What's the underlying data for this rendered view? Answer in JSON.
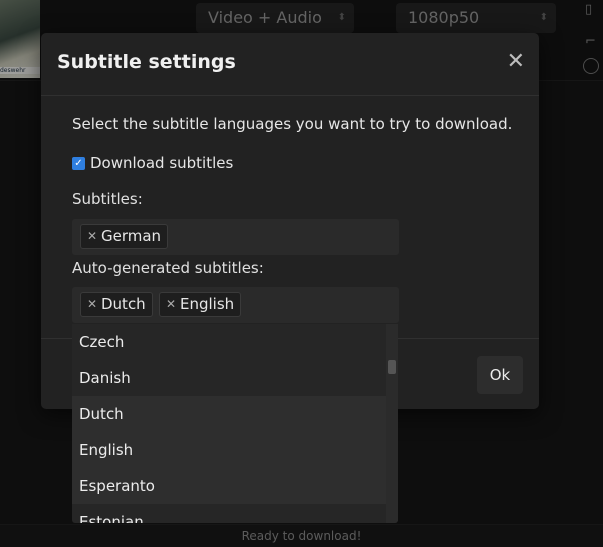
{
  "background": {
    "thumbnail_caption": "deswehr",
    "format_select": "Video + Audio",
    "quality_select": "1080p50",
    "status_text": "Ready to download!"
  },
  "modal": {
    "title": "Subtitle settings",
    "close_icon": "close-icon",
    "intro": "Select the subtitle languages you want to try to download.",
    "download_checkbox_label": "Download subtitles",
    "download_checked": true,
    "subtitles_label": "Subtitles:",
    "subtitles_tags": [
      "German"
    ],
    "auto_label": "Auto-generated subtitles:",
    "auto_tags": [
      "Dutch",
      "English"
    ],
    "ok_label": "Ok",
    "accent_color": "#2f7fe0"
  },
  "dropdown": {
    "items": [
      "Czech",
      "Danish",
      "Dutch",
      "English",
      "Esperanto",
      "Estonian"
    ]
  }
}
